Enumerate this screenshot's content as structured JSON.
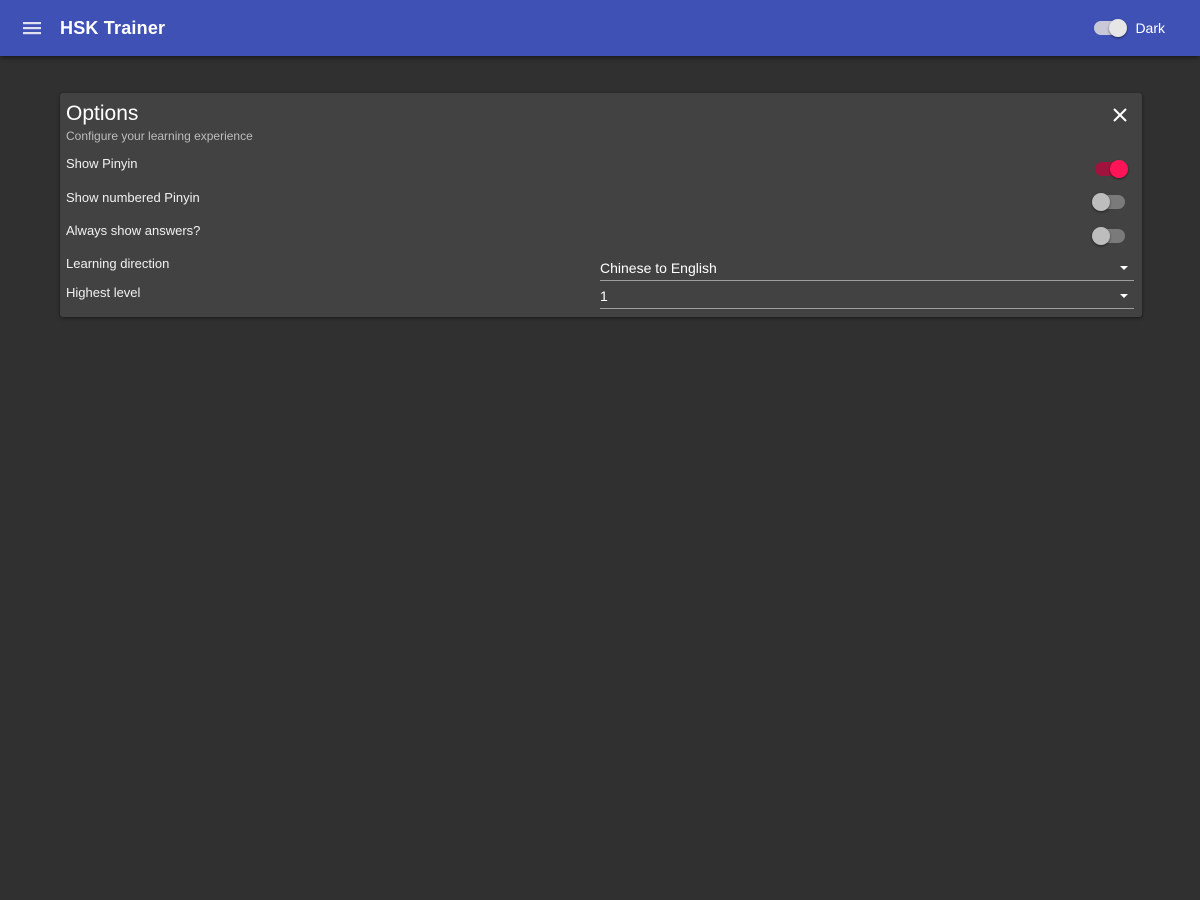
{
  "appbar": {
    "menu_icon": "menu-icon",
    "title": "HSK Trainer",
    "theme_toggle": {
      "label": "Dark",
      "on": true
    }
  },
  "options": {
    "title": "Options",
    "subtitle": "Configure your learning experience",
    "close_icon": "close-icon",
    "show_pinyin": {
      "label": "Show Pinyin",
      "on": true
    },
    "show_numbered_pinyin": {
      "label": "Show numbered Pinyin",
      "on": false
    },
    "always_show_answers": {
      "label": "Always show answers?",
      "on": false
    },
    "learning_direction": {
      "label": "Learning direction",
      "value": "Chinese to English"
    },
    "highest_level": {
      "label": "Highest level",
      "value": "1"
    }
  },
  "colors": {
    "appbar": "#3f51b5",
    "background": "#303030",
    "card": "#424242",
    "accent": "#ff1458"
  }
}
